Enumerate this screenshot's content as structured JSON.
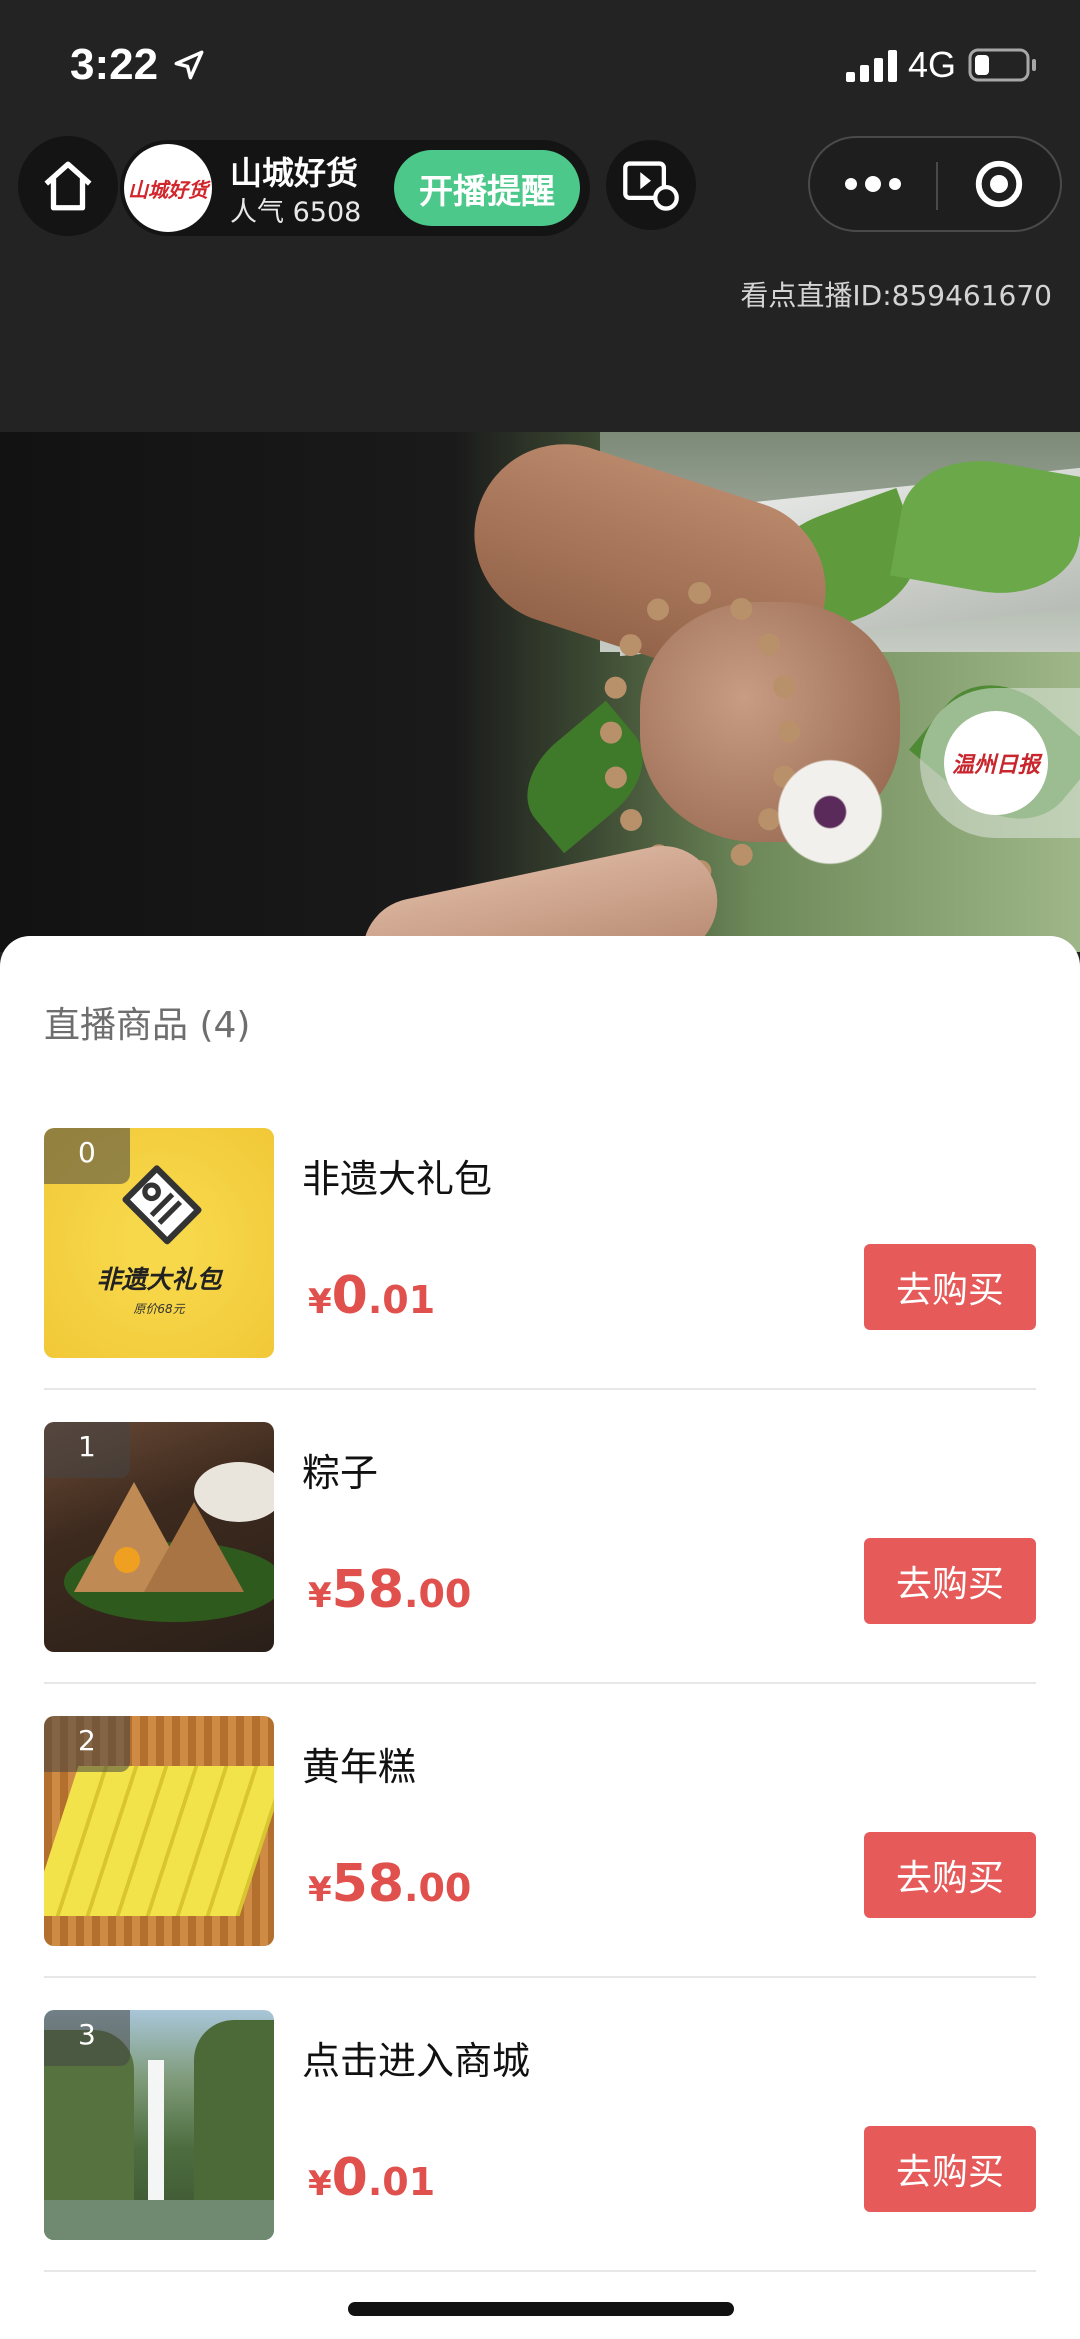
{
  "status_bar": {
    "time": "3:22",
    "network": "4G",
    "battery_level": 0.3
  },
  "anchor": {
    "avatar_text": "山城好货",
    "name": "山城好货",
    "popularity": "人气 6508",
    "remind_label": "开播提醒"
  },
  "live_id": "看点直播ID:859461670",
  "badge_text": "温州日报",
  "sheet": {
    "title": "直播商品 (4)",
    "products": [
      {
        "index": "0",
        "name": "非遗大礼包",
        "price_symbol": "¥",
        "price_int": "0",
        "price_dec": ".01",
        "buy_label": "去购买",
        "thumb_text": "非遗大礼包",
        "thumb_sub": "原价68元"
      },
      {
        "index": "1",
        "name": "粽子",
        "price_symbol": "¥",
        "price_int": "58",
        "price_dec": ".00",
        "buy_label": "去购买"
      },
      {
        "index": "2",
        "name": "黄年糕",
        "price_symbol": "¥",
        "price_int": "58",
        "price_dec": ".00",
        "buy_label": "去购买"
      },
      {
        "index": "3",
        "name": "点击进入商城",
        "price_symbol": "¥",
        "price_int": "0",
        "price_dec": ".01",
        "buy_label": "去购买"
      }
    ]
  },
  "colors": {
    "accent_green": "#4cc98a",
    "price_red": "#e0504d",
    "buy_red": "#e65a5a"
  }
}
